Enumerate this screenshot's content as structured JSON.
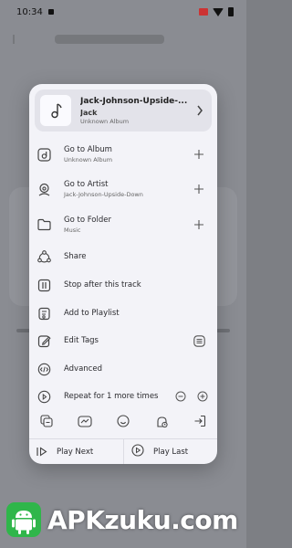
{
  "status_bar": {
    "time": "10:34"
  },
  "song": {
    "title": "Jack-Johnson-Upside-...",
    "artist": "Jack",
    "album": "Unknown Album"
  },
  "menu": [
    {
      "label": "Go to Album",
      "sub": "Unknown Album",
      "icon": "album-icon",
      "action_icon": "add-icon"
    },
    {
      "label": "Go to Artist",
      "sub": "Jack-Johnson-Upside-Down",
      "icon": "artist-icon",
      "action_icon": "add-icon"
    },
    {
      "label": "Go to Folder",
      "sub": "Music",
      "icon": "folder-icon",
      "action_icon": "add-icon"
    },
    {
      "label": "Share",
      "icon": "share-icon"
    },
    {
      "label": "Stop after this track",
      "icon": "stop-after-icon"
    },
    {
      "label": "Add to Playlist",
      "icon": "add-playlist-icon"
    },
    {
      "label": "Edit Tags",
      "icon": "edit-icon",
      "action_icon": "tag-list-icon"
    },
    {
      "label": "Advanced",
      "icon": "code-icon"
    },
    {
      "label": "Repeat for 1 more times",
      "icon": "repeat-icon"
    }
  ],
  "quick_icons": [
    "equalizer-icon",
    "ringtone-icon",
    "emoji-icon",
    "alarm-icon",
    "exit-icon"
  ],
  "play_next": "Play Next",
  "play_last": "Play Last",
  "watermark": "APKzuku.com",
  "colors": {
    "sheet": "#f3f3f8",
    "card": "#e3e3ea",
    "text": "#2a2a2e",
    "watermark_green": "#2fb64a"
  }
}
